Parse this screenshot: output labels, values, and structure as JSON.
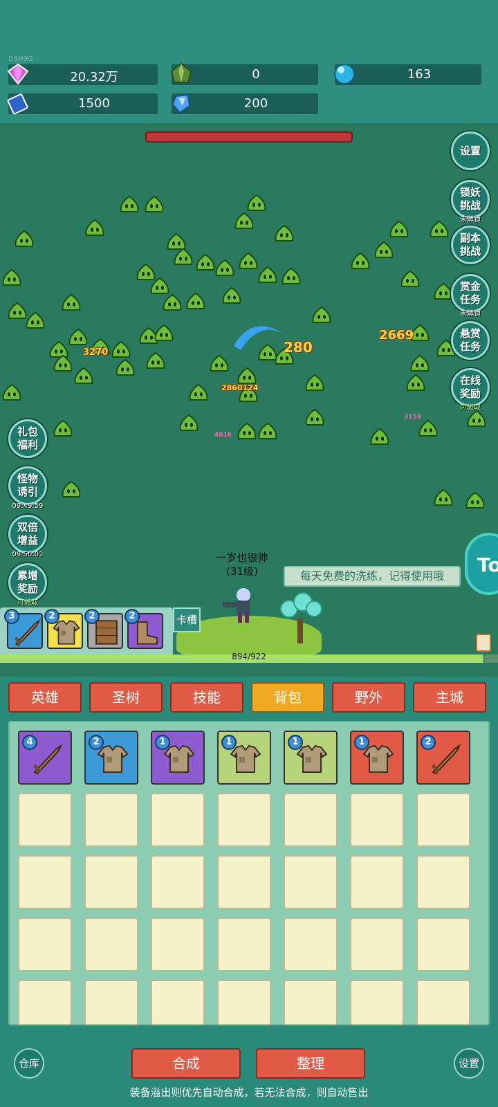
{
  "header": {
    "tag": "DSH9G",
    "resources": [
      {
        "icon": "purple-gem-icon",
        "value": "20.32万"
      },
      {
        "icon": "green-crystal-icon",
        "value": "0"
      },
      {
        "icon": "blue-orb-icon",
        "value": "163"
      },
      {
        "icon": "blue-book-icon",
        "value": "1500"
      },
      {
        "icon": "blue-shard-icon",
        "value": "200"
      }
    ]
  },
  "right_menu": [
    {
      "label": "设置",
      "sub": ""
    },
    {
      "label": "锁妖挑战",
      "sub": "未解锁"
    },
    {
      "label": "副本挑战",
      "sub": ""
    },
    {
      "label": "赏金任务",
      "sub": "未解锁"
    },
    {
      "label": "悬赏任务",
      "sub": ""
    },
    {
      "label": "在线奖励",
      "sub": "可领取"
    }
  ],
  "left_menu": [
    {
      "label": "礼包福利",
      "sub": ""
    },
    {
      "label": "怪物诱引",
      "sub": "09:49:59"
    },
    {
      "label": "双倍增益",
      "sub": "09:50:01"
    },
    {
      "label": "累增奖励",
      "sub": "可领取"
    }
  ],
  "damage_numbers": [
    "280",
    "2669",
    "3270",
    "2860124",
    "4816",
    "3159"
  ],
  "hero": {
    "name": "一岁也很帅",
    "level": "(31级)"
  },
  "hint": "每天免费的洗练，记得使用哦",
  "tok_label": "To",
  "card_slot": {
    "label": "卡槽",
    "cards": [
      {
        "level": "3",
        "item": "sword",
        "color": "#3d9ad8"
      },
      {
        "level": "2",
        "item": "armor",
        "color": "#f3e04a"
      },
      {
        "level": "2",
        "item": "shield",
        "color": "#a7a7a7"
      },
      {
        "level": "2",
        "item": "boots",
        "color": "#8e5bd1"
      }
    ]
  },
  "exp": {
    "text": "894/922",
    "current": 894,
    "max": 922
  },
  "tabs": [
    {
      "label": "英雄",
      "active": false
    },
    {
      "label": "圣树",
      "active": false
    },
    {
      "label": "技能",
      "active": false
    },
    {
      "label": "背包",
      "active": true
    },
    {
      "label": "野外",
      "active": false
    },
    {
      "label": "主城",
      "active": false
    }
  ],
  "inventory": [
    {
      "level": "4",
      "item": "sword",
      "color": "#8e5bd1"
    },
    {
      "level": "2",
      "item": "armor",
      "color": "#3d9ad8"
    },
    {
      "level": "1",
      "item": "armor",
      "color": "#8e5bd1"
    },
    {
      "level": "1",
      "item": "armor",
      "color": "#b6d27a"
    },
    {
      "level": "1",
      "item": "armor",
      "color": "#b6d27a"
    },
    {
      "level": "1",
      "item": "armor",
      "color": "#e05a45"
    },
    {
      "level": "2",
      "item": "sword",
      "color": "#e05a45"
    }
  ],
  "bottom": {
    "warehouse": "仓库",
    "merge": "合成",
    "sort": "整理",
    "settings": "设置",
    "note": "装备溢出则优先自动合成，若无法合成，则自动售出"
  }
}
